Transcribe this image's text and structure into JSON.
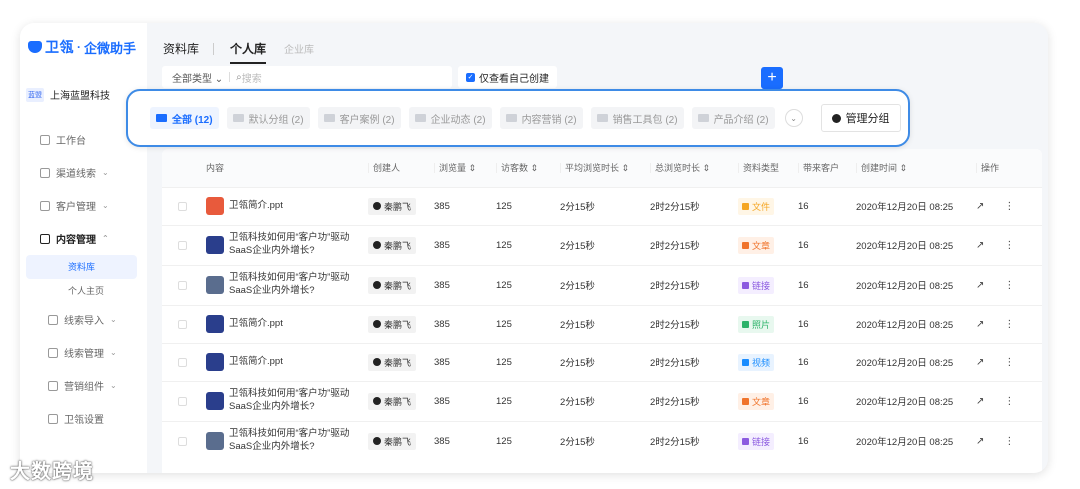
{
  "brand": {
    "name": "卫瓴",
    "separator": "·",
    "product": "企微助手"
  },
  "org": {
    "badge": "蓝盟",
    "name": "上海蓝盟科技"
  },
  "nav": [
    {
      "label": "工作台",
      "icon": "monitor-icon",
      "has_chevron": false
    },
    {
      "label": "渠道线索",
      "icon": "channel-icon",
      "has_chevron": true
    },
    {
      "label": "客户管理",
      "icon": "users-icon",
      "has_chevron": true
    },
    {
      "label": "内容管理",
      "icon": "copy-icon",
      "has_chevron": true,
      "active": true
    }
  ],
  "nav_sub": [
    {
      "label": "资料库",
      "active": true
    },
    {
      "label": "个人主页"
    }
  ],
  "nav2": [
    {
      "label": "线索导入",
      "icon": "import-icon"
    },
    {
      "label": "线索管理",
      "icon": "lead-icon"
    },
    {
      "label": "营销组件",
      "icon": "folder-icon"
    },
    {
      "label": "卫瓴设置",
      "icon": "settings-icon"
    }
  ],
  "chevron_down": "⌄",
  "chevron_up": "⌃",
  "header": {
    "title": "资料库",
    "tabs": [
      {
        "label": "个人库",
        "active": true
      },
      {
        "label": "企业库",
        "active": false
      }
    ]
  },
  "filters": {
    "type_select": "全部类型",
    "search_placeholder": "搜索",
    "only_mine": "仅查看自己创建",
    "add": "+"
  },
  "groups": [
    {
      "label": "全部 (12)",
      "active": true
    },
    {
      "label": "默认分组 (2)"
    },
    {
      "label": "客户案例 (2)"
    },
    {
      "label": "企业动态 (2)"
    },
    {
      "label": "内容营销 (2)"
    },
    {
      "label": "销售工具包 (2)"
    },
    {
      "label": "产品介绍 (2)"
    }
  ],
  "more_groups": "⌄",
  "manage_groups": "管理分组",
  "table": {
    "headers": [
      "内容",
      "创建人",
      "浏览量 ⇕",
      "访客数 ⇕",
      "平均浏览时长 ⇕",
      "总浏览时长 ⇕",
      "资料类型",
      "带来客户",
      "创建时间 ⇕",
      "操作"
    ],
    "rows": [
      {
        "thumb": "ppt",
        "title": "卫瓴简介.ppt",
        "creator": "秦鹏飞",
        "views": "385",
        "visitors": "125",
        "avg": "2分15秒",
        "total": "2时2分15秒",
        "type": "文件",
        "type_color": "#f5a623",
        "type_bg": "#fff6e6",
        "customers": "16",
        "created": "2020年12月20日 08:25"
      },
      {
        "thumb": "blue",
        "title": "卫瓴科技如何用“客户功”驱动SaaS企业内外增长?",
        "creator": "秦鹏飞",
        "views": "385",
        "visitors": "125",
        "avg": "2分15秒",
        "total": "2时2分15秒",
        "type": "文章",
        "type_color": "#f0742c",
        "type_bg": "#fff0e6",
        "customers": "16",
        "created": "2020年12月20日 08:25"
      },
      {
        "thumb": "person",
        "title": "卫瓴科技如何用“客户功”驱动SaaS企业内外增长?",
        "creator": "秦鹏飞",
        "views": "385",
        "visitors": "125",
        "avg": "2分15秒",
        "total": "2时2分15秒",
        "type": "链接",
        "type_color": "#8c5be0",
        "type_bg": "#f4eeff",
        "customers": "16",
        "created": "2020年12月20日 08:25"
      },
      {
        "thumb": "blue",
        "title": "卫瓴简介.ppt",
        "creator": "秦鹏飞",
        "views": "385",
        "visitors": "125",
        "avg": "2分15秒",
        "total": "2时2分15秒",
        "type": "照片",
        "type_color": "#2cb36a",
        "type_bg": "#e8f8ef",
        "customers": "16",
        "created": "2020年12月20日 08:25"
      },
      {
        "thumb": "blue",
        "title": "卫瓴简介.ppt",
        "creator": "秦鹏飞",
        "views": "385",
        "visitors": "125",
        "avg": "2分15秒",
        "total": "2时2分15秒",
        "type": "视频",
        "type_color": "#1a8dff",
        "type_bg": "#e8f3ff",
        "customers": "16",
        "created": "2020年12月20日 08:25"
      },
      {
        "thumb": "blue",
        "title": "卫瓴科技如何用“客户功”驱动SaaS企业内外增长?",
        "creator": "秦鹏飞",
        "views": "385",
        "visitors": "125",
        "avg": "2分15秒",
        "total": "2时2分15秒",
        "type": "文章",
        "type_color": "#f0742c",
        "type_bg": "#fff0e6",
        "customers": "16",
        "created": "2020年12月20日 08:25"
      },
      {
        "thumb": "person",
        "title": "卫瓴科技如何用“客户功”驱动SaaS企业内外增长?",
        "creator": "秦鹏飞",
        "views": "385",
        "visitors": "125",
        "avg": "2分15秒",
        "total": "2时2分15秒",
        "type": "链接",
        "type_color": "#8c5be0",
        "type_bg": "#f4eeff",
        "customers": "16",
        "created": "2020年12月20日 08:25"
      }
    ],
    "op_share": "↗",
    "op_more": "⋮"
  },
  "watermark": "大数跨境"
}
